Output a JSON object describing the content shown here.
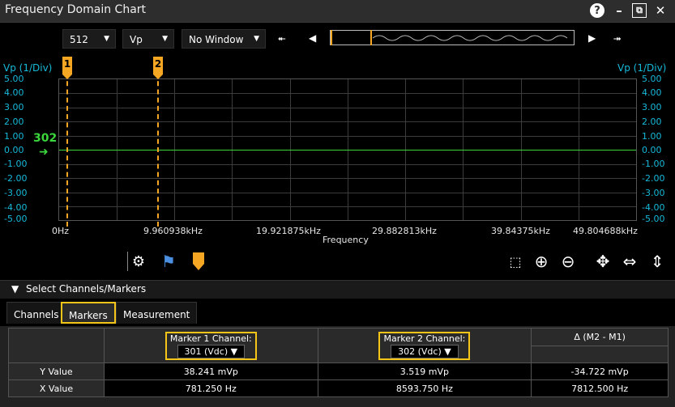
{
  "window": {
    "title": "Frequency Domain Chart",
    "help": "?",
    "minimize": "–",
    "restore": "⧉",
    "close": "✕"
  },
  "toolbar": {
    "points": "512",
    "units": "Vp",
    "window_type": "No Window",
    "nav": {
      "first": "⯬",
      "prev": "◀",
      "next": "▶",
      "last": "⯮"
    }
  },
  "chart": {
    "y_label_left": "Vp (1/Div)",
    "y_label_right": "Vp (1/Div)",
    "y_ticks": [
      "5.00",
      "4.00",
      "3.00",
      "2.00",
      "1.00",
      "0.00",
      "-1.00",
      "-2.00",
      "-3.00",
      "-4.00",
      "-5.00"
    ],
    "x_ticks": [
      "0Hz",
      "9.960938kHz",
      "19.921875kHz",
      "29.882813kHz",
      "39.84375kHz",
      "49.804688kHz"
    ],
    "x_title": "Frequency",
    "channel_label": "302",
    "markers": [
      "1",
      "2"
    ]
  },
  "chart_data": {
    "type": "line",
    "xlabel": "Frequency",
    "ylabel": "Vp (1/Div)",
    "ylim": [
      -5,
      5
    ],
    "series": [
      {
        "name": "302",
        "x": [
          0,
          49804.688
        ],
        "y": [
          0.0,
          0.0
        ]
      }
    ],
    "markers": [
      {
        "label": "1",
        "x": 781.25
      },
      {
        "label": "2",
        "x": 8593.75
      }
    ]
  },
  "section": {
    "title": "Select Channels/Markers"
  },
  "tabs": [
    "Channels",
    "Markers",
    "Measurement"
  ],
  "marker_table": {
    "headers": [
      "",
      "Marker 1 Channel:",
      "Marker 2 Channel:",
      "Δ (M2 - M1)"
    ],
    "channel_selects": [
      "301 (Vdc)",
      "302 (Vdc)"
    ],
    "rows": [
      {
        "label": "Y Value",
        "m1": "38.241 mVp",
        "m2": "3.519 mVp",
        "delta": "-34.722 mVp"
      },
      {
        "label": "X Value",
        "m1": "781.250  Hz",
        "m2": "8593.750  Hz",
        "delta": "7812.500  Hz"
      }
    ]
  },
  "colors": {
    "accent": "#f5a623",
    "highlight": "#f5c518",
    "trace": "#3bd63b",
    "axis": "#17b9d9"
  }
}
